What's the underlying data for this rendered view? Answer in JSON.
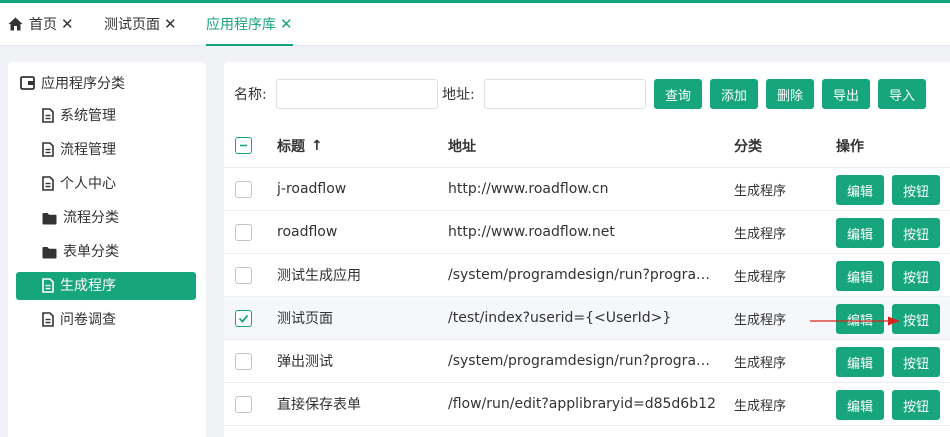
{
  "tabs": [
    {
      "label": "首页",
      "closable": true,
      "active": false
    },
    {
      "label": "测试页面",
      "closable": true,
      "active": false
    },
    {
      "label": "应用程序库",
      "closable": true,
      "active": true
    }
  ],
  "close_glyph": "✕",
  "sidebar": {
    "root_label": "应用程序分类",
    "items": [
      {
        "label": "系统管理",
        "icon": "file-icon"
      },
      {
        "label": "流程管理",
        "icon": "file-icon"
      },
      {
        "label": "个人中心",
        "icon": "file-icon"
      },
      {
        "label": "流程分类",
        "icon": "folder-icon"
      },
      {
        "label": "表单分类",
        "icon": "folder-icon"
      },
      {
        "label": "生成程序",
        "icon": "file-icon",
        "active": true
      },
      {
        "label": "问卷调查",
        "icon": "file-icon"
      }
    ]
  },
  "search": {
    "name_label": "名称:",
    "name_value": "",
    "address_label": "地址:",
    "address_value": "",
    "buttons": [
      "查询",
      "添加",
      "删除",
      "导出",
      "导入"
    ]
  },
  "table": {
    "headers": {
      "title": "标题",
      "sort_arrow": "↑",
      "address": "地址",
      "category": "分类",
      "actions": "操作"
    },
    "rows": [
      {
        "title": "j-roadflow",
        "address": "http://www.roadflow.cn",
        "category": "生成程序",
        "checked": false
      },
      {
        "title": "roadflow",
        "address": "http://www.roadflow.net",
        "category": "生成程序",
        "checked": false
      },
      {
        "title": "测试生成应用",
        "address": "/system/programdesign/run?programid=",
        "category": "生成程序",
        "checked": false
      },
      {
        "title": "测试页面",
        "address": "/test/index?userid={<UserId>}",
        "category": "生成程序",
        "checked": true
      },
      {
        "title": "弹出测试",
        "address": "/system/programdesign/run?programid=",
        "category": "生成程序",
        "checked": false
      },
      {
        "title": "直接保存表单",
        "address": "/flow/run/edit?applibraryid=d85d6b12",
        "category": "生成程序",
        "checked": false
      }
    ],
    "row_buttons": {
      "edit": "编辑",
      "button": "按钮"
    }
  },
  "colors": {
    "accent": "#17a57e",
    "arrow": "#d9261c"
  }
}
